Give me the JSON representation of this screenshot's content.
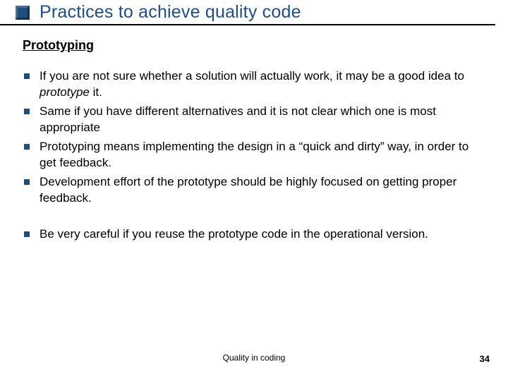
{
  "title": "Practices to achieve quality code",
  "subtitle": "Prototyping",
  "bullets_group1": [
    {
      "pre": "If you are not sure whether a solution will actually work, it may be a good idea to ",
      "em": "prototype",
      "post": " it."
    },
    {
      "pre": "Same if you have different alternatives and it is not clear which one is most appropriate",
      "em": "",
      "post": ""
    },
    {
      "pre": "Prototyping means implementing the design in a “quick and dirty” way, in order to get feedback.",
      "em": "",
      "post": ""
    },
    {
      "pre": "Development effort of the prototype should be highly focused on getting proper feedback.",
      "em": "",
      "post": ""
    }
  ],
  "bullets_group2": [
    {
      "pre": "Be very careful if you reuse the prototype code in the operational version.",
      "em": "",
      "post": ""
    }
  ],
  "footer_center": "Quality in coding",
  "page_number": "34"
}
